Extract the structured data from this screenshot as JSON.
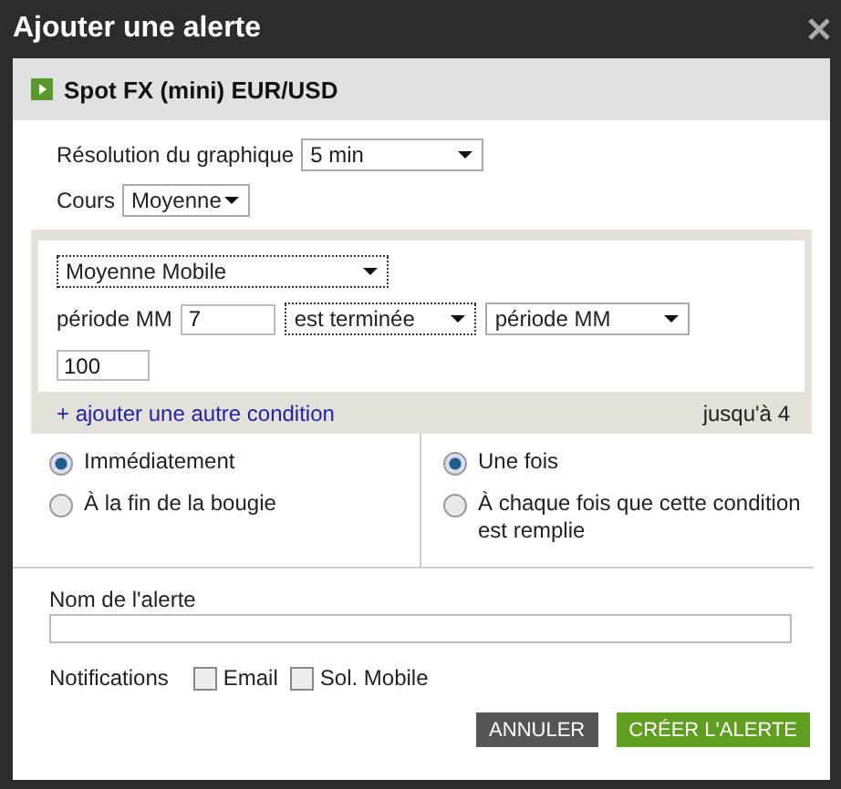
{
  "window": {
    "title": "Ajouter une alerte"
  },
  "instrument": {
    "name": "Spot FX (mini) EUR/USD"
  },
  "settings": [
    {
      "label": "Résolution du graphique",
      "value": "5 min"
    },
    {
      "label": "Cours",
      "value": "Moyenne"
    }
  ],
  "condition": {
    "rows": [
      [
        {
          "kind": "select",
          "value": "Moyenne Mobile",
          "focused": true
        }
      ],
      [
        {
          "kind": "label",
          "text": "période MM"
        },
        {
          "kind": "input",
          "value": "7"
        },
        {
          "kind": "select",
          "value": "est terminée",
          "focused": true
        },
        {
          "kind": "select",
          "value": "période MM",
          "focused": false
        }
      ],
      [
        {
          "kind": "input",
          "value": "100"
        }
      ]
    ],
    "add_link": "+ ajouter une autre condition",
    "limit": "jusqu'à 4"
  },
  "timing": [
    {
      "label": "Immédiatement",
      "selected": true
    },
    {
      "label": "À la fin de la bougie",
      "selected": false
    }
  ],
  "frequency": [
    {
      "label": "Une fois",
      "selected": true
    },
    {
      "label": "À chaque fois que cette condition est remplie",
      "selected": false
    }
  ],
  "name_field": {
    "label": "Nom de l'alerte"
  },
  "notifications": {
    "label": "Notifications",
    "options": [
      {
        "label": "Email",
        "checked": false
      },
      {
        "label": "Sol. Mobile",
        "checked": false
      }
    ]
  },
  "buttons": [
    {
      "label": "ANNULER",
      "kind": "secondary"
    },
    {
      "label": "CRÉER L'ALERTE",
      "kind": "primary"
    }
  ]
}
